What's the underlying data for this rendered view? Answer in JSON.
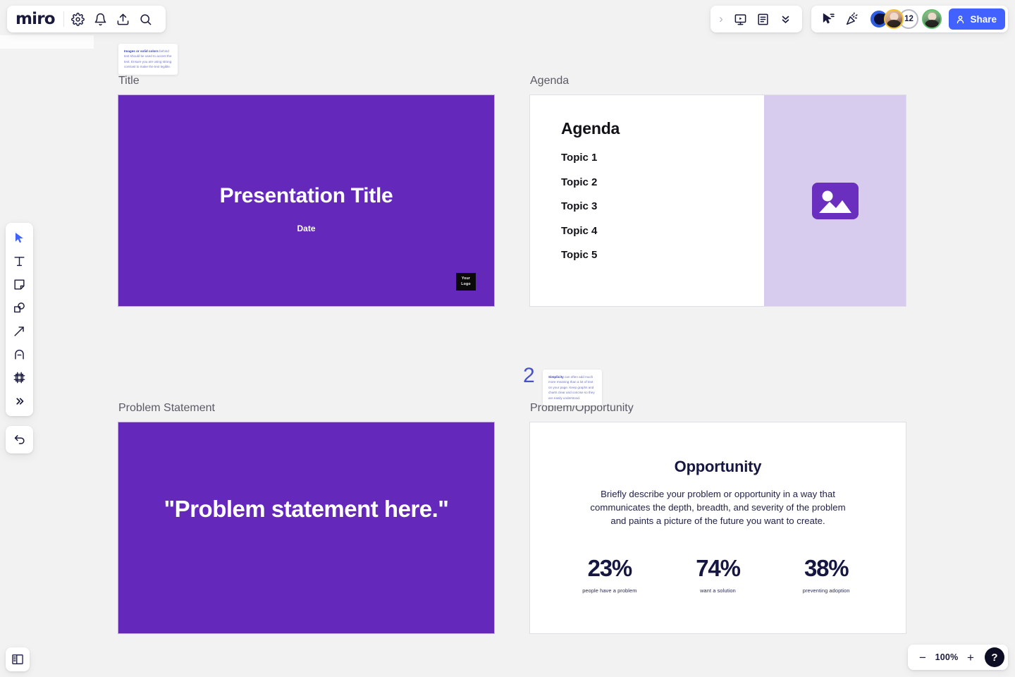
{
  "app": {
    "name": "miro",
    "canvas_background": "#f2f2f2"
  },
  "header": {
    "logo_text": "miro",
    "left_icons": [
      {
        "name": "settings-gear-icon",
        "label": "Settings"
      },
      {
        "name": "notifications-bell-icon",
        "label": "Notifications"
      },
      {
        "name": "upload-icon",
        "label": "Upload"
      },
      {
        "name": "search-icon",
        "label": "Search"
      }
    ],
    "center_group": {
      "expand_label": "›",
      "icons": [
        {
          "name": "presentation-icon",
          "label": "Presentation mode"
        },
        {
          "name": "notes-icon",
          "label": "Notes"
        },
        {
          "name": "chevrons-down-icon",
          "label": "More"
        }
      ]
    },
    "right_group": {
      "icons": [
        {
          "name": "cursor-share-icon",
          "label": "Bring to me"
        },
        {
          "name": "celebrate-icon",
          "label": "Celebrate"
        }
      ],
      "avatars": [
        {
          "name": "avatar-brand",
          "type": "logo",
          "color": "#2f5fe0"
        },
        {
          "name": "avatar-user-1",
          "type": "photo",
          "ring_color": "#f4c430"
        },
        {
          "name": "avatar-overflow-count",
          "type": "count",
          "count": "12"
        },
        {
          "name": "avatar-user-2",
          "type": "photo",
          "ring_color": "#5ec16a"
        }
      ],
      "share_button": {
        "label": "Share",
        "color": "#4262ff"
      }
    }
  },
  "left_toolbar": {
    "items": [
      {
        "name": "tool-select",
        "label": "Select",
        "active": true
      },
      {
        "name": "tool-text",
        "label": "Text"
      },
      {
        "name": "tool-sticky-note",
        "label": "Sticky note"
      },
      {
        "name": "tool-shapes",
        "label": "Shapes"
      },
      {
        "name": "tool-connector",
        "label": "Connection line"
      },
      {
        "name": "tool-pen",
        "label": "Pen"
      },
      {
        "name": "tool-frame",
        "label": "Frame"
      },
      {
        "name": "tool-more",
        "label": "More apps"
      }
    ],
    "undo": {
      "name": "undo-button",
      "label": "Undo"
    }
  },
  "bottom_left": {
    "panel_toggle": {
      "name": "toggle-panel-button",
      "label": "Open frames panel"
    }
  },
  "zoom_controls": {
    "zoom_out_label": "−",
    "zoom_level": "100%",
    "zoom_in_label": "+",
    "help_label": "?"
  },
  "frames": [
    {
      "id": "title",
      "label": "Title",
      "background": "#6429bb",
      "heading": "Presentation Title",
      "date": "Date",
      "logo_line1": "Your",
      "logo_line2": "Logo"
    },
    {
      "id": "agenda",
      "label": "Agenda",
      "heading": "Agenda",
      "topics": [
        "Topic 1",
        "Topic 2",
        "Topic 3",
        "Topic 4",
        "Topic 5"
      ],
      "panel_color": "#d8ccee",
      "image_placeholder": "image-placeholder-icon"
    },
    {
      "id": "problem",
      "label": "Problem Statement",
      "background": "#6429bb",
      "quote": "\"Problem statement here.\""
    },
    {
      "id": "opportunity",
      "label": "Problem/Opportunity",
      "heading": "Opportunity",
      "body": "Briefly describe your problem or opportunity in a way that communicates the depth, breadth, and severity of the problem and paints a picture of the future you want to create.",
      "stats": [
        {
          "value": "23%",
          "label": "people have a problem"
        },
        {
          "value": "74%",
          "label": "want a solution"
        },
        {
          "value": "38%",
          "label": "preventing adoption"
        }
      ]
    }
  ],
  "tips": [
    {
      "id": "tip-1",
      "lead": "Images or solid colors",
      "rest": " behind text should be used to accent the text. Ensure you are using strong contrast to make the text legible."
    },
    {
      "id": "tip-2",
      "number": "2",
      "lead": "Simplicity",
      "rest": " can often add much more meaning than a lot of text on your page. Keep graphs and charts clear and concise so they are easily understood."
    }
  ]
}
